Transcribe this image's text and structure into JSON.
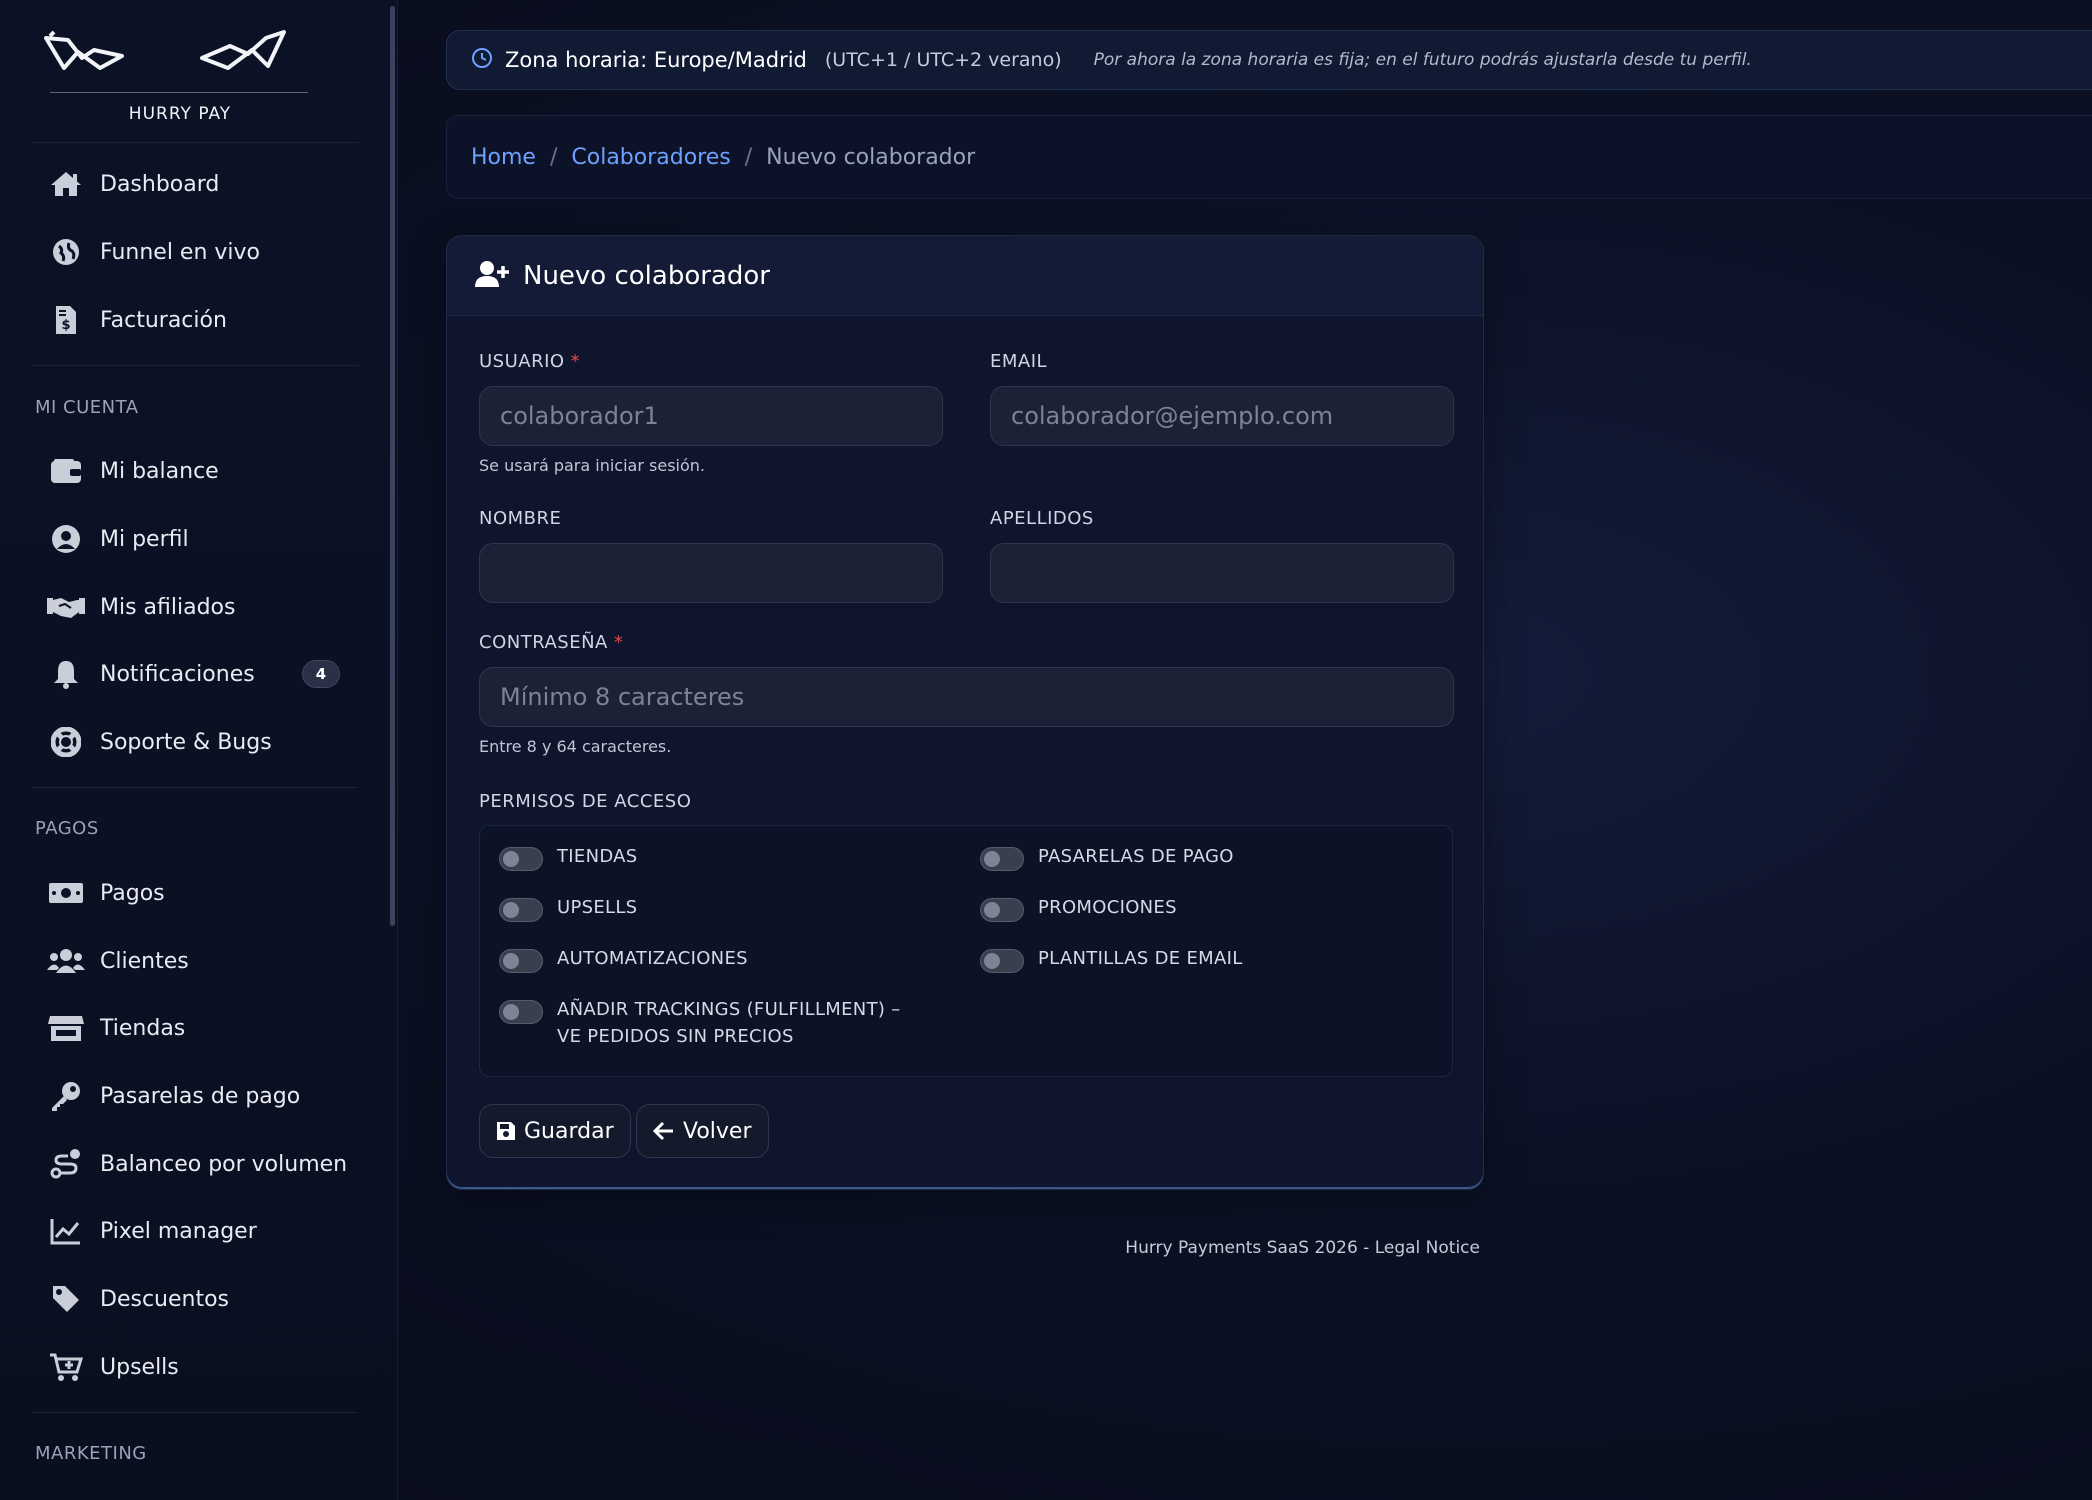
{
  "brand": {
    "name": "HURRY PAY"
  },
  "sidebar": {
    "main_items": [
      {
        "label": "Dashboard",
        "icon": "home-icon"
      },
      {
        "label": "Funnel en vivo",
        "icon": "globe-icon"
      },
      {
        "label": "Facturación",
        "icon": "invoice-icon"
      }
    ],
    "section_account": "MI CUENTA",
    "account_items": [
      {
        "label": "Mi balance",
        "icon": "wallet-icon"
      },
      {
        "label": "Mi perfil",
        "icon": "user-circle-icon"
      },
      {
        "label": "Mis afiliados",
        "icon": "handshake-icon"
      },
      {
        "label": "Notificaciones",
        "icon": "bell-icon",
        "badge": "4"
      },
      {
        "label": "Soporte & Bugs",
        "icon": "lifebuoy-icon"
      }
    ],
    "section_payments": "PAGOS",
    "payment_items": [
      {
        "label": "Pagos",
        "icon": "money-icon"
      },
      {
        "label": "Clientes",
        "icon": "users-icon"
      },
      {
        "label": "Tiendas",
        "icon": "store-icon"
      },
      {
        "label": "Pasarelas de pago",
        "icon": "key-icon"
      },
      {
        "label": "Balanceo por volumen",
        "icon": "route-icon"
      },
      {
        "label": "Pixel manager",
        "icon": "chart-line-icon"
      },
      {
        "label": "Descuentos",
        "icon": "tag-icon"
      },
      {
        "label": "Upsells",
        "icon": "cart-plus-icon"
      }
    ],
    "section_marketing": "MARKETING"
  },
  "timezone": {
    "title": "Zona horaria: Europe/Madrid",
    "offset": "(UTC+1 / UTC+2 verano)",
    "note": "Por ahora la zona horaria es fija; en el futuro podrás ajustarla desde tu perfil."
  },
  "breadcrumb": {
    "home": "Home",
    "parent": "Colaboradores",
    "current": "Nuevo colaborador",
    "sep": "/"
  },
  "form": {
    "title": "Nuevo colaborador",
    "usuario": {
      "label": "USUARIO",
      "placeholder": "colaborador1",
      "help": "Se usará para iniciar sesión.",
      "required": "*"
    },
    "email": {
      "label": "EMAIL",
      "placeholder": "colaborador@ejemplo.com"
    },
    "nombre": {
      "label": "NOMBRE",
      "placeholder": ""
    },
    "apellidos": {
      "label": "APELLIDOS",
      "placeholder": ""
    },
    "password": {
      "label": "CONTRASEÑA",
      "placeholder": "Mínimo 8 caracteres",
      "help": "Entre 8 y 64 caracteres.",
      "required": "*"
    },
    "permissions_label": "PERMISOS DE ACCESO",
    "permissions": [
      {
        "label": "TIENDAS",
        "enabled": false
      },
      {
        "label": "PASARELAS DE PAGO",
        "enabled": false
      },
      {
        "label": "UPSELLS",
        "enabled": false
      },
      {
        "label": "PROMOCIONES",
        "enabled": false
      },
      {
        "label": "AUTOMATIZACIONES",
        "enabled": false
      },
      {
        "label": "PLANTILLAS DE EMAIL",
        "enabled": false
      },
      {
        "label": "AÑADIR TRACKINGS (FULFILLMENT) – VE PEDIDOS SIN PRECIOS",
        "enabled": false
      }
    ],
    "save_label": "Guardar",
    "back_label": "Volver"
  },
  "footer": {
    "text": "Hurry Payments SaaS 2026 - Legal Notice"
  }
}
